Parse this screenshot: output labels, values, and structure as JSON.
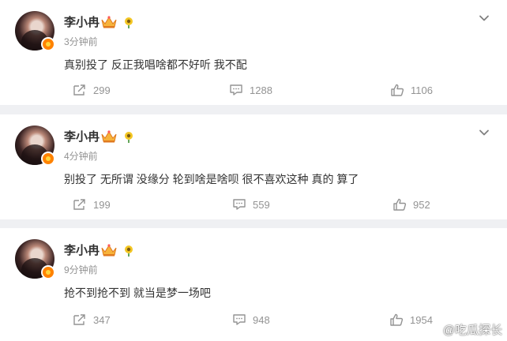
{
  "accent": "#ff8200",
  "posts": [
    {
      "author": "李小冉",
      "time": "3分钟前",
      "text": "真别投了 反正我唱啥都不好听 我不配",
      "reposts": "299",
      "comments": "1288",
      "likes": "1106"
    },
    {
      "author": "李小冉",
      "time": "4分钟前",
      "text": "别投了 无所谓 没缘分 轮到啥是啥呗 很不喜欢这种 真的  算了",
      "reposts": "199",
      "comments": "559",
      "likes": "952"
    },
    {
      "author": "李小冉",
      "time": "9分钟前",
      "text": "抢不到抢不到 就当是梦一场吧",
      "reposts": "347",
      "comments": "948",
      "likes": "1954"
    }
  ],
  "watermark": "@吃瓜探长",
  "icons": {
    "verified": "verified-badge-icon",
    "crown": "crown-icon",
    "sticker": "sticker-icon",
    "menu": "chevron-down-icon",
    "repost": "repost-icon",
    "comment": "comment-icon",
    "like": "thumbs-up-icon"
  }
}
